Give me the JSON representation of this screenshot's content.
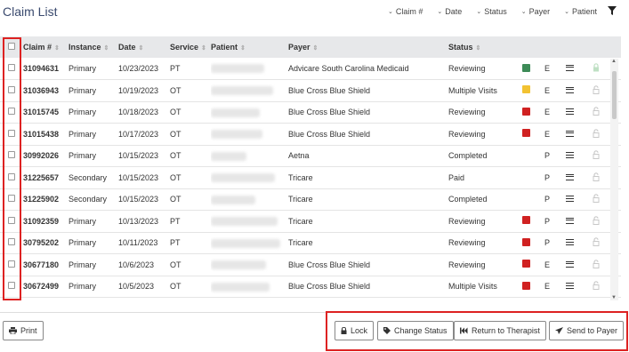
{
  "header": {
    "title": "Claim List",
    "sorts": [
      "Claim #",
      "Date",
      "Status",
      "Payer",
      "Patient"
    ]
  },
  "table": {
    "headers": [
      "Claim #",
      "Instance",
      "Date",
      "Service",
      "Patient",
      "Payer",
      "Status"
    ],
    "rows": [
      {
        "claim": "31094631",
        "instance": "Primary",
        "date": "10/23/2023",
        "service": "PT",
        "payer": "Advicare South Carolina Medicaid",
        "status": "Reviewing",
        "flag": "#3d8b57",
        "type": "E",
        "locked": true
      },
      {
        "claim": "31036943",
        "instance": "Primary",
        "date": "10/19/2023",
        "service": "OT",
        "payer": "Blue Cross Blue Shield",
        "status": "Multiple Visits",
        "flag": "#f2c232",
        "type": "E",
        "locked": false
      },
      {
        "claim": "31015745",
        "instance": "Primary",
        "date": "10/18/2023",
        "service": "OT",
        "payer": "Blue Cross Blue Shield",
        "status": "Reviewing",
        "flag": "#d02121",
        "type": "E",
        "locked": false
      },
      {
        "claim": "31015438",
        "instance": "Primary",
        "date": "10/17/2023",
        "service": "OT",
        "payer": "Blue Cross Blue Shield",
        "status": "Reviewing",
        "flag": "#d02121",
        "type": "E",
        "locked": false
      },
      {
        "claim": "30992026",
        "instance": "Primary",
        "date": "10/15/2023",
        "service": "OT",
        "payer": "Aetna",
        "status": "Completed",
        "flag": "",
        "type": "P",
        "locked": false
      },
      {
        "claim": "31225657",
        "instance": "Secondary",
        "date": "10/15/2023",
        "service": "OT",
        "payer": "Tricare",
        "status": "Paid",
        "flag": "",
        "type": "P",
        "locked": false
      },
      {
        "claim": "31225902",
        "instance": "Secondary",
        "date": "10/15/2023",
        "service": "OT",
        "payer": "Tricare",
        "status": "Completed",
        "flag": "",
        "type": "P",
        "locked": false
      },
      {
        "claim": "31092359",
        "instance": "Primary",
        "date": "10/13/2023",
        "service": "PT",
        "payer": "Tricare",
        "status": "Reviewing",
        "flag": "#d02121",
        "type": "P",
        "locked": false
      },
      {
        "claim": "30795202",
        "instance": "Primary",
        "date": "10/11/2023",
        "service": "PT",
        "payer": "Tricare",
        "status": "Reviewing",
        "flag": "#d02121",
        "type": "P",
        "locked": false
      },
      {
        "claim": "30677180",
        "instance": "Primary",
        "date": "10/6/2023",
        "service": "OT",
        "payer": "Blue Cross Blue Shield",
        "status": "Reviewing",
        "flag": "#d02121",
        "type": "E",
        "locked": false
      },
      {
        "claim": "30672499",
        "instance": "Primary",
        "date": "10/5/2023",
        "service": "OT",
        "payer": "Blue Cross Blue Shield",
        "status": "Multiple Visits",
        "flag": "#d02121",
        "type": "E",
        "locked": false
      }
    ]
  },
  "footer": {
    "print": "Print",
    "lock": "Lock",
    "change_status": "Change Status",
    "return_to_therapist": "Return to Therapist",
    "send_to_payer": "Send to Payer"
  },
  "colors": {
    "highlight": "#dd2222",
    "title": "#3a4a6e",
    "header_bg": "#e7e8ea"
  }
}
